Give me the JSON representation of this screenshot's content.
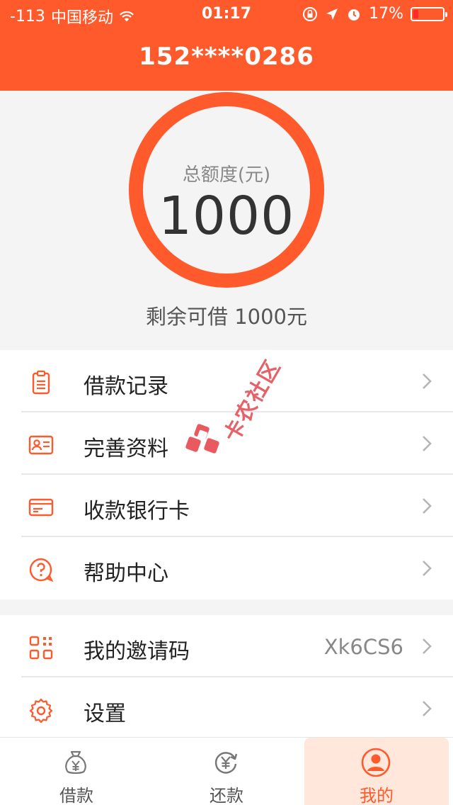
{
  "status_bar": {
    "signal": "-113",
    "carrier": "中国移动",
    "time": "01:17",
    "battery": "17%"
  },
  "header": {
    "title": "152****0286"
  },
  "credit": {
    "label": "总额度(元)",
    "value": "1000",
    "remaining_text": "剩余可借 1000元"
  },
  "menu_group_1": [
    {
      "label": "借款记录",
      "icon": "clipboard-icon"
    },
    {
      "label": "完善资料",
      "icon": "id-card-icon"
    },
    {
      "label": "收款银行卡",
      "icon": "bank-card-icon"
    },
    {
      "label": "帮助中心",
      "icon": "help-icon"
    }
  ],
  "menu_group_2": [
    {
      "label": "我的邀请码",
      "icon": "qrcode-icon",
      "value": "Xk6CS6"
    },
    {
      "label": "设置",
      "icon": "gear-icon"
    }
  ],
  "tabs": [
    {
      "label": "借款",
      "icon": "money-bag-icon",
      "active": false
    },
    {
      "label": "还款",
      "icon": "repay-icon",
      "active": false
    },
    {
      "label": "我的",
      "icon": "user-icon",
      "active": true
    }
  ],
  "watermark": {
    "text": "卡农社区"
  },
  "colors": {
    "primary": "#ff5a2c",
    "background": "#f4f4f4",
    "active_tab_bg": "#ffe7dc",
    "battery_low": "#ff2a2a"
  }
}
